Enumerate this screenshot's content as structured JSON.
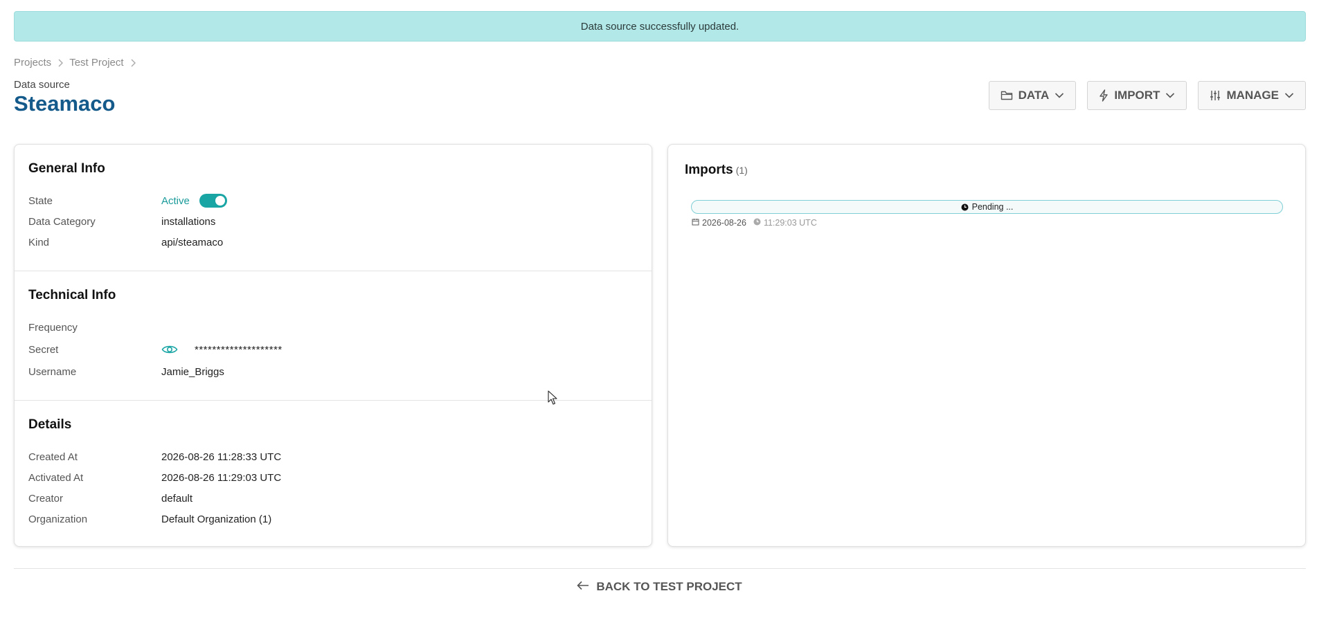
{
  "banner": {
    "message": "Data source successfully updated."
  },
  "breadcrumb": {
    "items": [
      "Projects",
      "Test Project"
    ]
  },
  "header": {
    "subtitle": "Data source",
    "title": "Steamaco"
  },
  "actions": {
    "data_label": "DATA",
    "import_label": "IMPORT",
    "manage_label": "MANAGE"
  },
  "general_info": {
    "title": "General Info",
    "state_label": "State",
    "state_value": "Active",
    "state_on": true,
    "category_label": "Data Category",
    "category_value": "installations",
    "kind_label": "Kind",
    "kind_value": "api/steamaco"
  },
  "technical_info": {
    "title": "Technical Info",
    "frequency_label": "Frequency",
    "frequency_value": "",
    "secret_label": "Secret",
    "secret_value": "********************",
    "username_label": "Username",
    "username_value": "Jamie_Briggs"
  },
  "details": {
    "title": "Details",
    "created_label": "Created At",
    "created_value": "2026-08-26 11:28:33 UTC",
    "activated_label": "Activated At",
    "activated_value": "2026-08-26 11:29:03 UTC",
    "creator_label": "Creator",
    "creator_value": "default",
    "org_label": "Organization",
    "org_value": "Default Organization (1)"
  },
  "imports": {
    "title": "Imports",
    "count": "(1)",
    "items": [
      {
        "status": "Pending ...",
        "date": "2026-08-26",
        "time": "11:29:03 UTC"
      }
    ]
  },
  "footer": {
    "back_label": "BACK TO TEST PROJECT"
  },
  "colors": {
    "accent": "#1aa5a5",
    "title": "#145a8a",
    "banner": "#b3e8e8"
  },
  "icons": [
    "chevron-right-icon",
    "folder-icon",
    "bolt-icon",
    "sliders-icon",
    "chevron-down-icon",
    "eye-icon",
    "clock-icon",
    "calendar-icon",
    "arrow-left-icon"
  ]
}
